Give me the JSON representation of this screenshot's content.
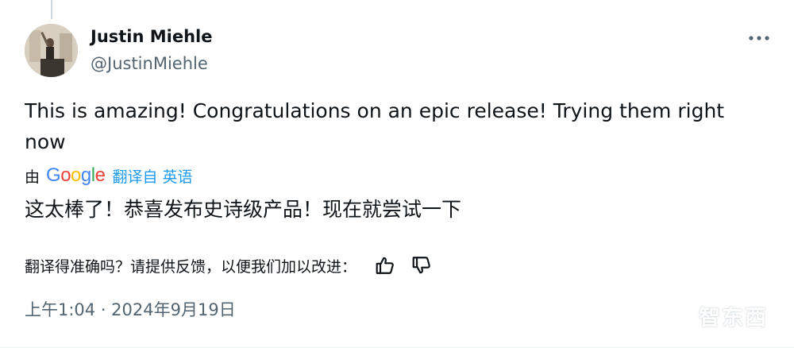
{
  "author": {
    "name": "Justin Miehle",
    "handle": "@JustinMiehle"
  },
  "tweet": {
    "text": "This is amazing! Congratulations on an epic release! Trying them right now"
  },
  "translation": {
    "by_label": "由",
    "google_letters": [
      {
        "char": "G",
        "color": "#4285F4"
      },
      {
        "char": "o",
        "color": "#EA4335"
      },
      {
        "char": "o",
        "color": "#FBBC05"
      },
      {
        "char": "g",
        "color": "#4285F4"
      },
      {
        "char": "l",
        "color": "#34A853"
      },
      {
        "char": "e",
        "color": "#EA4335"
      }
    ],
    "source_link": "翻译自 英语",
    "translated_text": "这太棒了！恭喜发布史诗级产品！现在就尝试一下"
  },
  "feedback": {
    "prompt": "翻译得准确吗？请提供反馈，以便我们加以改进：",
    "like_icon": "thumbs-up-icon",
    "dislike_icon": "thumbs-down-icon"
  },
  "timestamp": "上午1:04 · 2024年9月19日",
  "watermark": "智东西",
  "colors": {
    "primary_text": "#0f1419",
    "secondary_text": "#536471",
    "link": "#1d9bf0"
  }
}
